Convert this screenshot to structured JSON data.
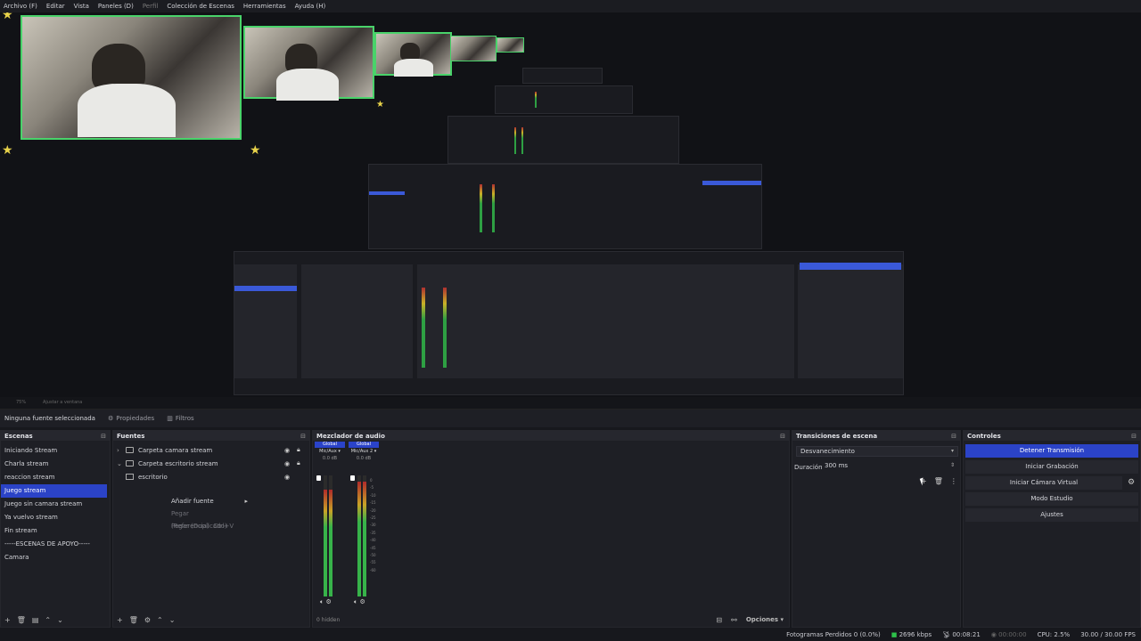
{
  "menu": {
    "items": [
      "Archivo (F)",
      "Editar",
      "Vista",
      "Paneles (D)",
      "Perfil",
      "Colección de Escenas",
      "Herramientas",
      "Ayuda (H)"
    ],
    "disabled_index": 4
  },
  "preview": {
    "status_left": [
      "75%",
      "Ajustar a ventana"
    ]
  },
  "context_bar": {
    "no_source": "Ninguna fuente seleccionada",
    "properties": "Propiedades",
    "filters": "Filtros"
  },
  "scenes": {
    "title": "Escenas",
    "items": [
      "Iniciando Stream",
      "Charla stream",
      "reaccion stream",
      "Juego stream",
      "Juego sin camara stream",
      "Ya vuelvo stream",
      "Fin stream",
      "-----ESCENAS DE APOYO-----",
      "Camara"
    ],
    "active_index": 3
  },
  "sources": {
    "title": "Fuentes",
    "items": [
      {
        "label": "Carpeta camara stream",
        "type": "folder"
      },
      {
        "label": "Carpeta escritorio stream",
        "type": "folder"
      },
      {
        "label": "escritorio",
        "type": "display"
      }
    ],
    "context_menu": {
      "add": "Añadir fuente",
      "paste_ref": "Pegar (Referencia)",
      "paste_ref_shortcut": "Ctrl+V",
      "paste_dup": "Pegar (Duplicado)"
    }
  },
  "mixer": {
    "title": "Mezclador de audio",
    "channels": [
      {
        "global": "Global",
        "name": "Mic/Aux",
        "db": "0.0 dB",
        "level": 0.88
      },
      {
        "global": "Global",
        "name": "Mic/Aux 2",
        "db": "0.0 dB",
        "level": 0.95
      }
    ],
    "ticks": [
      "0",
      "-5",
      "-10",
      "-15",
      "-20",
      "-25",
      "-30",
      "-35",
      "-40",
      "-45",
      "-50",
      "-55",
      "-60"
    ],
    "hidden_label": "0 hidden",
    "options": "Opciones"
  },
  "transitions": {
    "title": "Transiciones de escena",
    "selected": "Desvanecimiento",
    "duration_label": "Duración",
    "duration_value": "300 ms"
  },
  "controls": {
    "title": "Controles",
    "stop_stream": "Detener Transmisión",
    "start_recording": "Iniciar Grabación",
    "start_virtual_cam": "Iniciar Cámara Virtual",
    "studio_mode": "Modo Estudio",
    "settings": "Ajustes"
  },
  "status": {
    "dropped_frames": "Fotogramas Perdidos 0 (0.0%)",
    "bitrate": "2696 kbps",
    "stream_time": "00:08:21",
    "rec_time": "00:00:00",
    "cpu": "CPU: 2.5%",
    "fps": "30.00 / 30.00 FPS"
  },
  "colors": {
    "accent": "#2b43c7",
    "live": "#2ec14a",
    "bg": "#17181d"
  }
}
